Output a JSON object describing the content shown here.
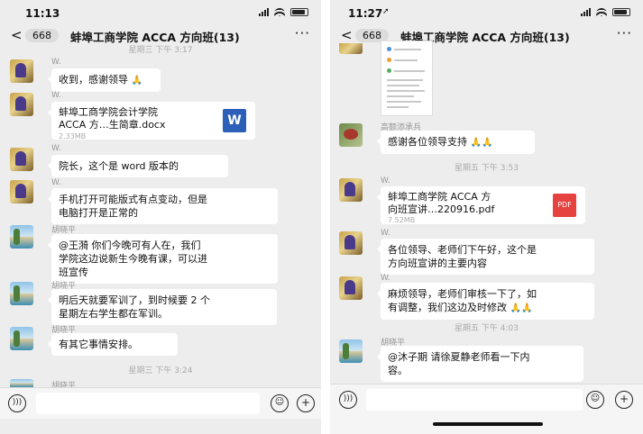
{
  "left": {
    "time": "11:13",
    "back": "<",
    "badge": "668",
    "title": "蚌埠工商学院 ACCA 方向班(13)",
    "more": "···",
    "top_timestamp": "星期三 下午 3:17",
    "messages": [
      {
        "sender": "W.",
        "text": "收到，感谢领导",
        "emoji": "🙏"
      },
      {
        "sender": "W.",
        "file_name_line1": "蚌埠工商学院会计学院",
        "file_name_line2": "ACCA 方…生简章.docx",
        "file_size": "2.33MB",
        "file_icon": "W"
      },
      {
        "sender": "W.",
        "text": "院长，这个是 word 版本的"
      },
      {
        "sender": "W.",
        "line1": "手机打开可能版式有点变动，但是",
        "line2": "电脑打开是正常的"
      },
      {
        "sender": "胡晓平",
        "line1": "@王漪 你们今晚可有人在，我们",
        "line2": "学院这边说新生今晚有课，可以进",
        "line3": "班宣传"
      },
      {
        "sender": "胡晓平",
        "line1": "明后天就要军训了，到时候要 2 个",
        "line2": "星期左右学生都在军训。"
      },
      {
        "sender": "胡晓平",
        "text": "有其它事情安排。"
      }
    ],
    "bottom_timestamp": "星期三 下午 3:24",
    "bottom_sender": "胡晓平",
    "voice_icon": "voice-icon",
    "emoji_icon": "emoji-icon",
    "plus_icon": "+"
  },
  "right": {
    "time": "11:27",
    "back": "<",
    "badge": "668",
    "title": "蚌埠工商学院 ACCA 方向班(13)",
    "more": "···",
    "messages": [
      {
        "sender": "高额添承兵",
        "text": "感谢各位领导支持",
        "emoji": "🙏🙏"
      },
      {
        "sender": "W.",
        "file_name_line1": "蚌埠工商学院 ACCA 方",
        "file_name_line2": "向班宣讲…220916.pdf",
        "file_size": "7.52MB",
        "file_icon": "PDF"
      },
      {
        "sender": "W.",
        "line1": "各位领导、老师们下午好，这个是",
        "line2": "方向班宣讲的主要内容"
      },
      {
        "sender": "W.",
        "line1": "麻烦领导，老师们审核一下了，如",
        "line2": "有调整，我们这边及时修改",
        "emoji": "🙏🙏"
      },
      {
        "sender": "胡晓平",
        "line1": "@沐子期 请徐夏静老师看一下内",
        "line2": "容。"
      }
    ],
    "timestamp1": "星期五 下午 3:53",
    "timestamp2": "星期五 下午 4:03",
    "plus_icon": "+"
  },
  "colors": {
    "background": "#ededed",
    "bubble": "#ffffff",
    "word": "#2b5fb8",
    "pdf": "#e64340"
  }
}
